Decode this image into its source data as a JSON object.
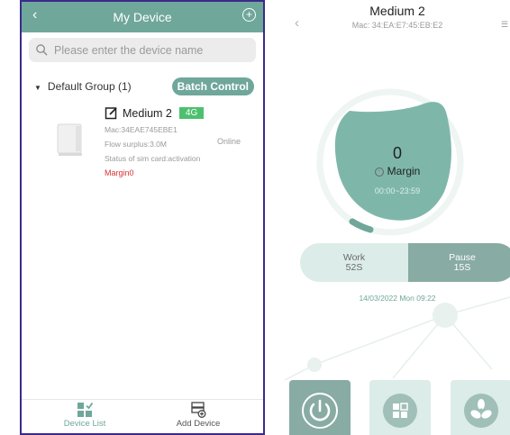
{
  "left": {
    "header": {
      "title": "My Device",
      "back_icon": "chevron-left-icon",
      "add_icon": "plus-circle-icon"
    },
    "search": {
      "placeholder": "Please enter the device name"
    },
    "group": {
      "label": "Default Group (1)",
      "batch_label": "Batch Control"
    },
    "device": {
      "name": "Medium 2",
      "badge": "4G",
      "mac": "Mac:34EAE745EBE1",
      "flow": "Flow surplus:3.0M",
      "sim": "Status of sim card:activation",
      "status": "Online",
      "margin": "Margin0"
    },
    "tabs": [
      {
        "label": "Device List",
        "icon": "grid-icon"
      },
      {
        "label": "Add Device",
        "icon": "add-device-icon"
      }
    ]
  },
  "right": {
    "header": {
      "title": "Medium 2",
      "mac": "Mac:  34:EA:E7:45:EB:E2",
      "back_icon": "chevron-left-icon",
      "menu_icon": "list-icon"
    },
    "gauge": {
      "value": "0",
      "label": "Margin",
      "time": "00:00~23:59"
    },
    "work": {
      "label": "Work",
      "value": "52S"
    },
    "pause": {
      "label": "Pause",
      "value": "15S"
    },
    "datetime": "14/03/2022 Mon 09:22",
    "controls": [
      "power-icon",
      "grid-icon",
      "fan-icon"
    ]
  },
  "colors": {
    "accent": "#6fa79a",
    "badge_green": "#4dc06f",
    "margin_red": "#d93232",
    "pause_bg": "#88aba3",
    "work_bg": "#dcece8"
  }
}
